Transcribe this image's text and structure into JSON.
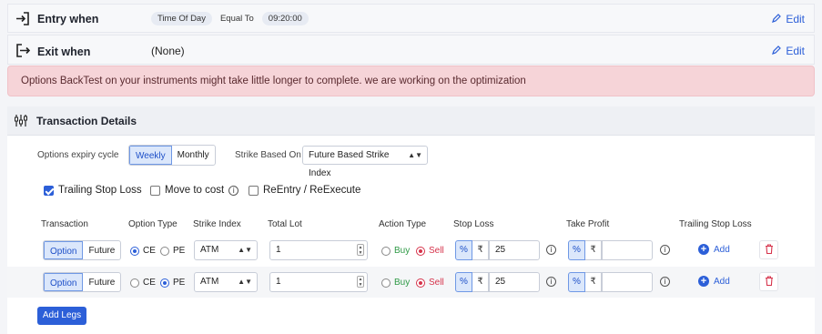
{
  "entry": {
    "title": "Entry when",
    "chips": [
      "Time Of Day",
      "Equal To",
      "09:20:00"
    ],
    "edit_label": "Edit"
  },
  "exit": {
    "title": "Exit when",
    "value": "(None)",
    "edit_label": "Edit"
  },
  "alert": {
    "text": "Options BackTest on your instruments might take little longer to complete. we are working on the optimization"
  },
  "transaction": {
    "title": "Transaction Details",
    "expiry_label": "Options expiry cycle",
    "expiry_options": [
      "Weekly",
      "Monthly"
    ],
    "expiry_selected": "Weekly",
    "strike_based_label": "Strike Based On",
    "strike_based_value": "Future Based Strike Index",
    "checkboxes": [
      {
        "label": "Trailing Stop Loss",
        "checked": true
      },
      {
        "label": "Move to cost",
        "checked": false
      },
      {
        "label": "ReEntry / ReExecute",
        "checked": false
      }
    ],
    "columns": [
      "Transaction",
      "Option Type",
      "Strike Index",
      "Total Lot",
      "Action Type",
      "Stop Loss",
      "Take Profit",
      "Trailing Stop Loss"
    ],
    "legs": [
      {
        "transaction": [
          "Option",
          "Future"
        ],
        "transaction_selected": "Option",
        "option_type": [
          "CE",
          "PE"
        ],
        "option_selected": "CE",
        "strike": "ATM",
        "lot": "1",
        "action": [
          "Buy",
          "Sell"
        ],
        "action_selected": "Sell",
        "sl_unit": "%",
        "sl_currency": "₹",
        "sl_value": "25",
        "tp_unit": "%",
        "tp_currency": "₹",
        "tp_value": "",
        "tsl_label": "Add"
      },
      {
        "transaction": [
          "Option",
          "Future"
        ],
        "transaction_selected": "Option",
        "option_type": [
          "CE",
          "PE"
        ],
        "option_selected": "PE",
        "strike": "ATM",
        "lot": "1",
        "action": [
          "Buy",
          "Sell"
        ],
        "action_selected": "Sell",
        "sl_unit": "%",
        "sl_currency": "₹",
        "sl_value": "25",
        "tp_unit": "%",
        "tp_currency": "₹",
        "tp_value": "",
        "tsl_label": "Add"
      }
    ],
    "add_legs_label": "Add Legs"
  },
  "colors": {
    "accent": "#2c5fd8",
    "sell": "#d6334b",
    "buy": "#2e9a46",
    "alert_bg": "#f6d4d8"
  }
}
